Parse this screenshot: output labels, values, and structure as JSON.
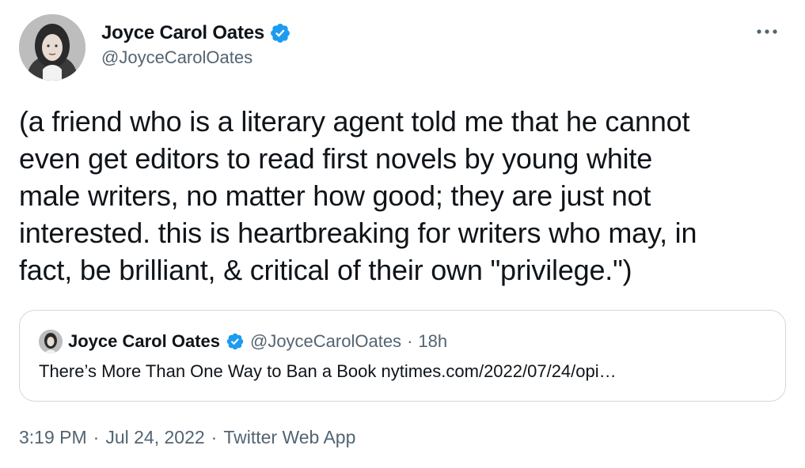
{
  "author": {
    "display_name": "Joyce Carol Oates",
    "handle": "@JoyceCarolOates",
    "verified_icon": "verified-badge-icon",
    "avatar_icon": "profile-photo"
  },
  "more_icon": "more-horizontal-icon",
  "tweet": {
    "text": "(a friend who is a literary agent told me that he cannot\neven get editors to read first novels by young white\nmale writers, no matter how good; they are just not\ninterested. this is heartbreaking for writers who may, in\nfact, be brilliant, & critical of their own \"privilege.\")"
  },
  "quoted_tweet": {
    "display_name": "Joyce Carol Oates",
    "handle": "@JoyceCarolOates",
    "separator": "·",
    "time": "18h",
    "text": "There’s More Than One Way to Ban a Book nytimes.com/2022/07/24/opi…"
  },
  "meta": {
    "time": "3:19 PM",
    "sep1": "·",
    "date": "Jul 24, 2022",
    "sep2": "·",
    "source": "Twitter Web App"
  },
  "colors": {
    "verified": "#1d9bf0",
    "text_primary": "#0f1419",
    "text_secondary": "#536471",
    "border": "#cfd9de"
  }
}
